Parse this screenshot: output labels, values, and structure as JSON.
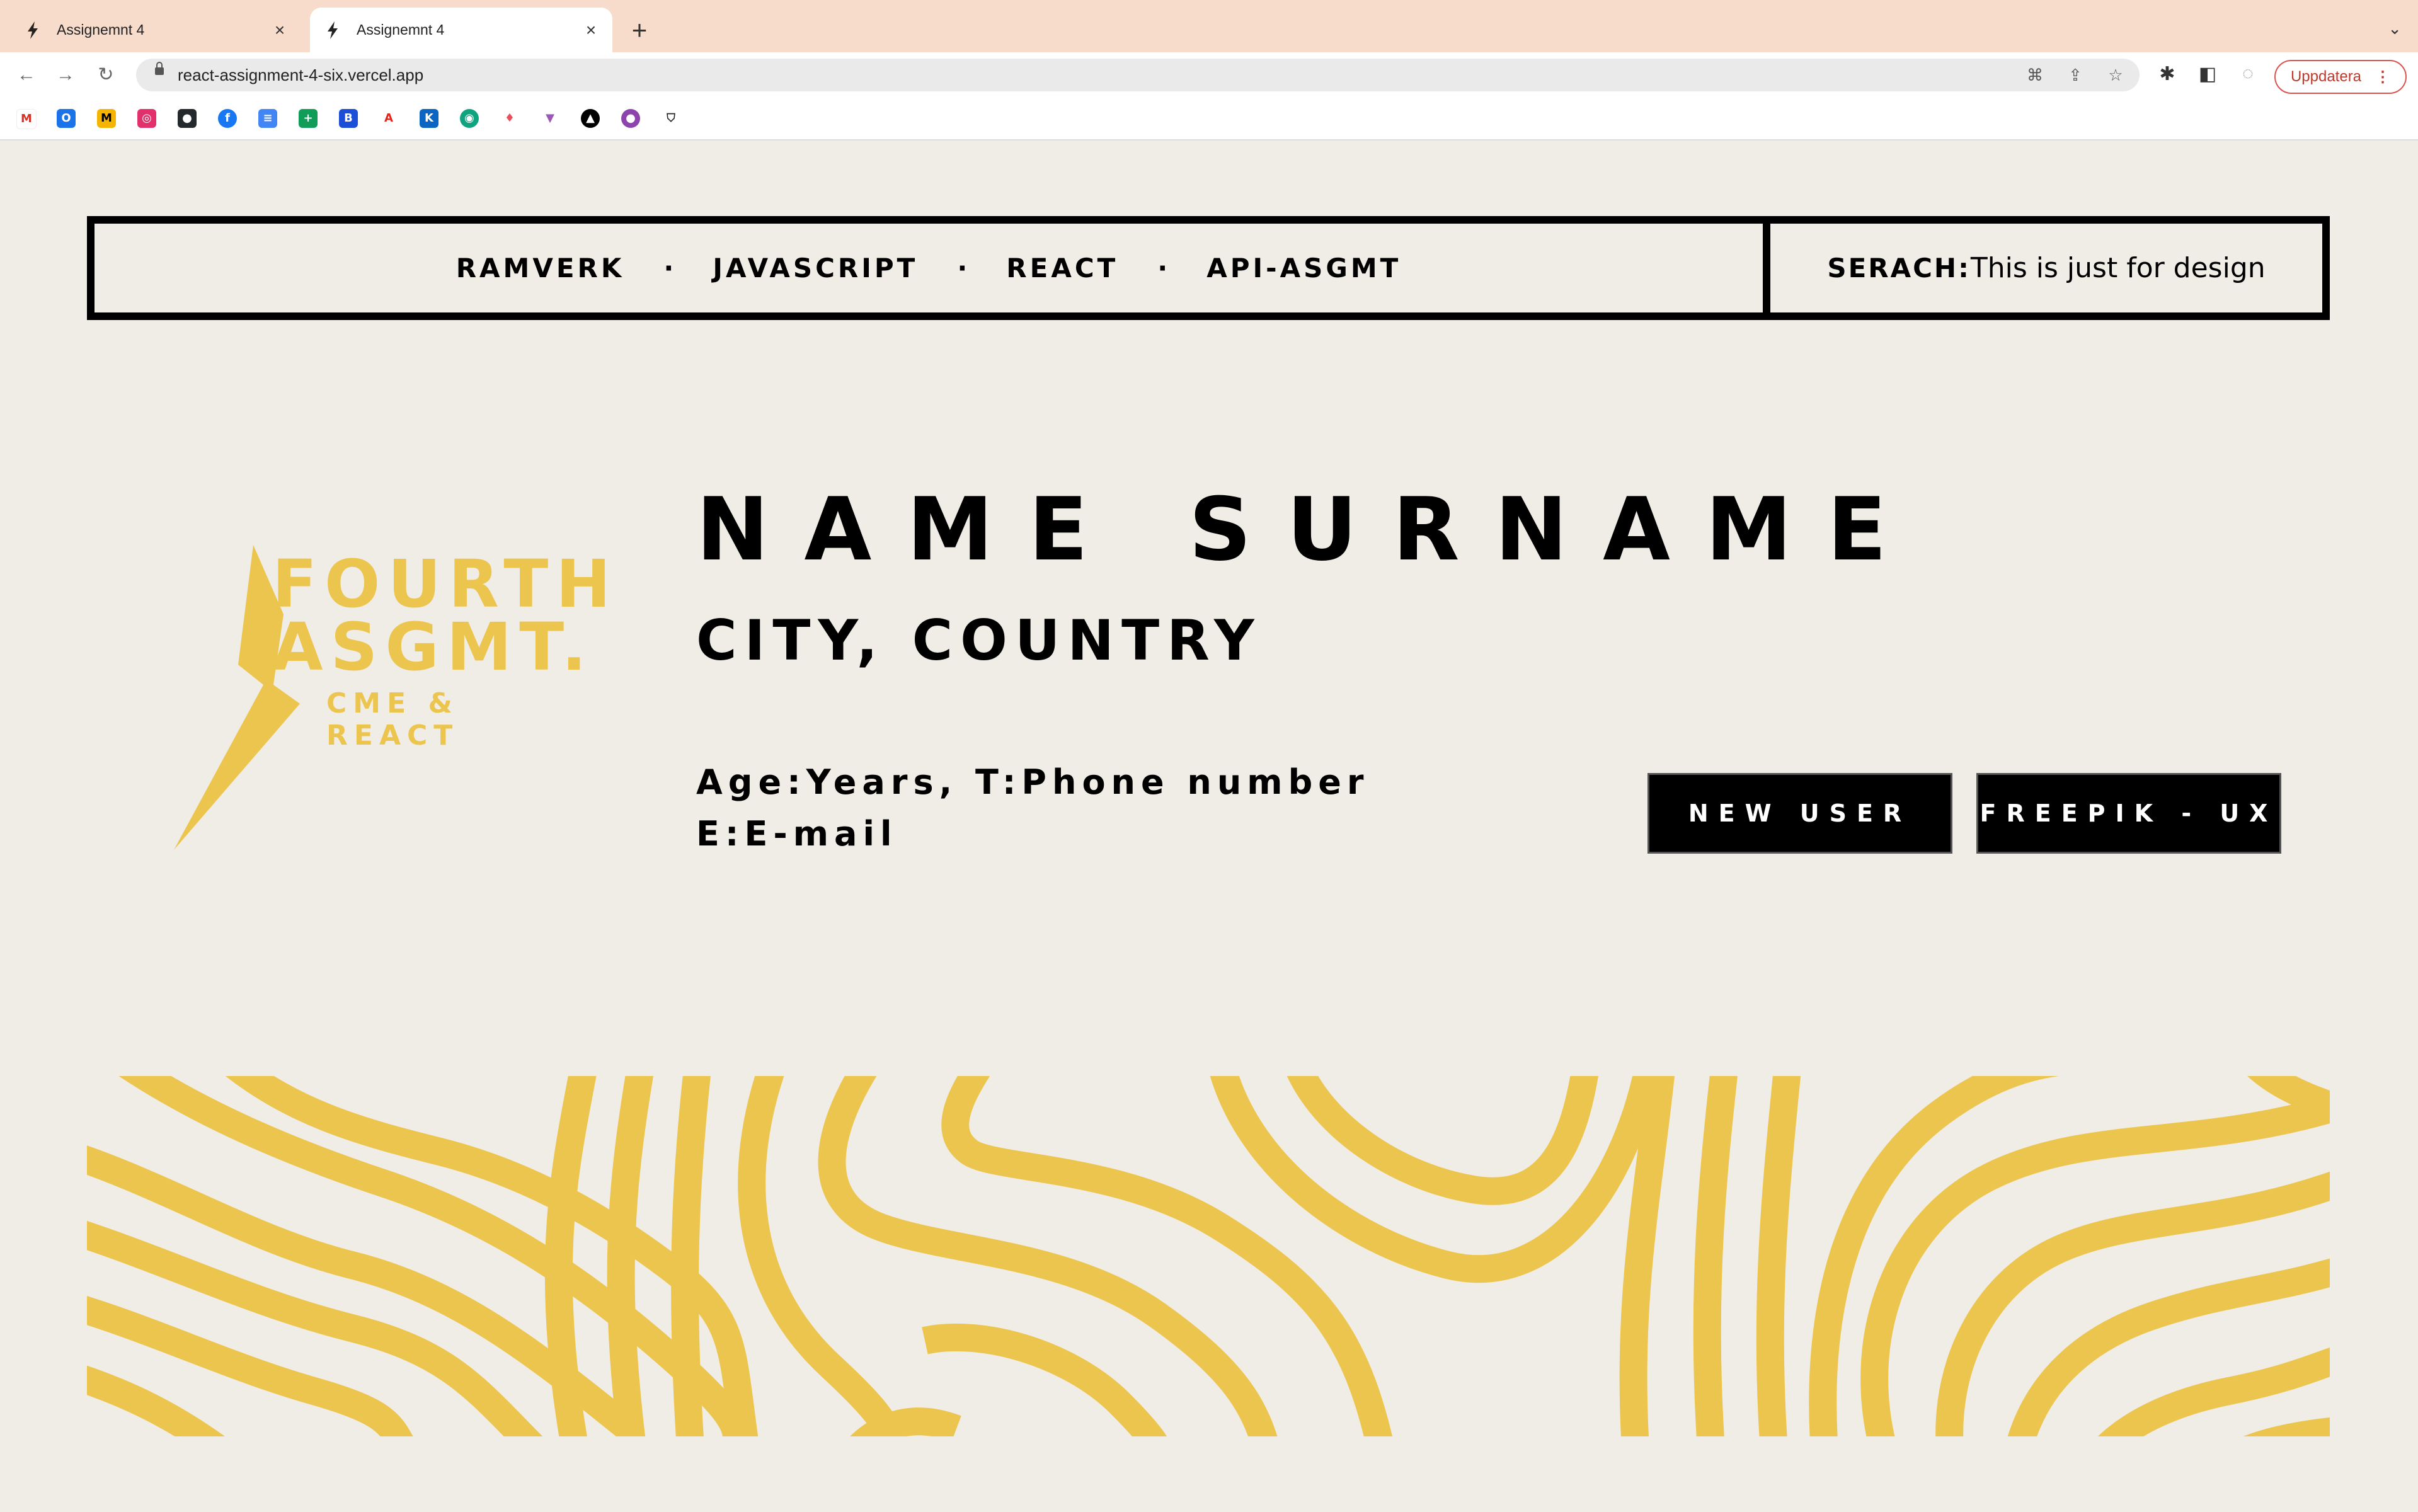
{
  "browser": {
    "tabs": [
      {
        "title": "Assignemnt 4",
        "active": false
      },
      {
        "title": "Assignemnt 4",
        "active": true
      }
    ],
    "url": "react-assignment-4-six.vercel.app",
    "update_label": "Uppdatera"
  },
  "nav": {
    "links": [
      "RAMVERK",
      "JAVASCRIPT",
      "REACT",
      "API-ASGMT"
    ],
    "search_label": "SERACH:",
    "search_text": "This is just for design"
  },
  "logo": {
    "line1": "FOURTH",
    "line2": "ASGMT.",
    "subtitle": "CME & REACT",
    "color": "#ecc54f"
  },
  "profile": {
    "name": "NAME SURNAME",
    "location": "CITY, COUNTRY",
    "age_phone": "Age:Years, T:Phone number",
    "email": "E:E-mail"
  },
  "buttons": {
    "new_user": "NEW USER",
    "freepik": "FREEPIK - UX"
  },
  "colors": {
    "background": "#f0ede6",
    "accent": "#ecc54f",
    "tab_bar": "#f8dccb"
  }
}
